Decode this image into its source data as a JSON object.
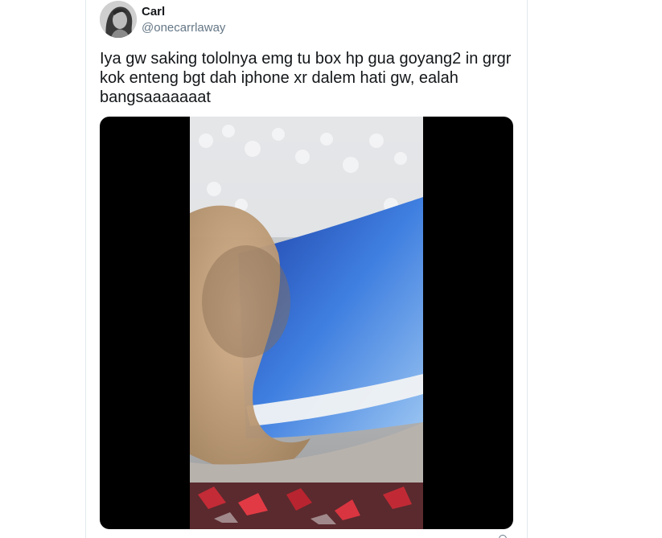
{
  "tweet": {
    "display_name": "Carl",
    "handle": "@onecarrlaway",
    "text": "Iya gw saking tololnya emg tu box hp gua goyang2 in grgr\nkok enteng bgt dah iphone xr dalem hati gw, ealah\nbangsaaaaaaat",
    "avatar_icon": "user-avatar-photo",
    "media_type": "video",
    "media_icon": "video-thumbnail"
  },
  "colors": {
    "name": "#14171a",
    "handle": "#657786",
    "border": "#e1e8ed",
    "media_bg": "#000000"
  }
}
